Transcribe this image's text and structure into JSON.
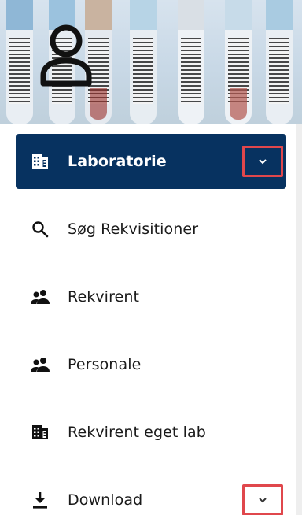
{
  "header": {
    "avatar_icon": "user-outline-icon"
  },
  "nav": {
    "items": [
      {
        "label": "Laboratorie",
        "icon": "building-icon",
        "active": true,
        "expandable": true
      },
      {
        "label": "Søg Rekvisitioner",
        "icon": "search-icon",
        "active": false,
        "expandable": false
      },
      {
        "label": "Rekvirent",
        "icon": "people-icon",
        "active": false,
        "expandable": false
      },
      {
        "label": "Personale",
        "icon": "people-icon",
        "active": false,
        "expandable": false
      },
      {
        "label": "Rekvirent eget lab",
        "icon": "building-icon",
        "active": false,
        "expandable": false
      },
      {
        "label": "Download",
        "icon": "download-icon",
        "active": false,
        "expandable": true
      }
    ]
  },
  "colors": {
    "active_bg": "#073260",
    "highlight_border": "#e0474c",
    "text": "#1a1a1a"
  }
}
